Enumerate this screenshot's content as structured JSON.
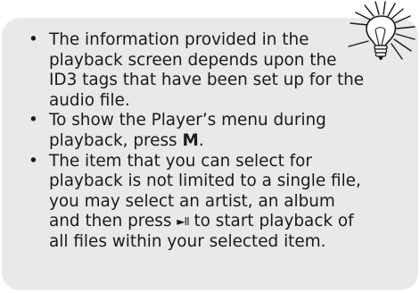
{
  "tip": {
    "items": [
      {
        "text": "The information provided in the playback screen depends upon the ID3 tags that have been set up for the audio file."
      },
      {
        "text_before": "To show the Player’s menu during playback, press ",
        "key": "M",
        "text_after": "."
      },
      {
        "text_before": "The item that you can select for playback is not limited to a single file, you may select an artist, an album and then press ",
        "play_pause_symbol": "►II",
        "text_after": " to start playback of all files within your selected item."
      }
    ],
    "icon": "lightbulb-icon",
    "colors": {
      "box_background": "#e9e9e9",
      "text": "#1a1a1a"
    }
  }
}
